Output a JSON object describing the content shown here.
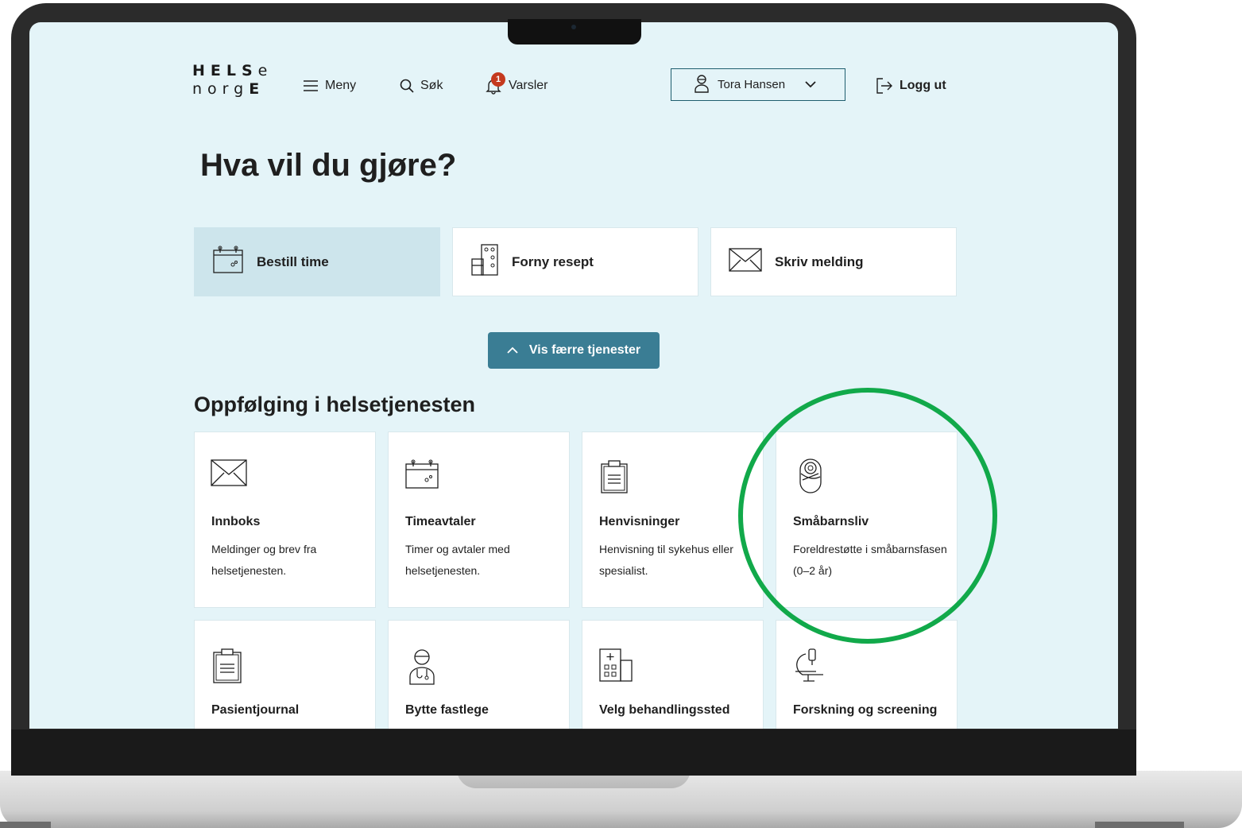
{
  "header": {
    "logo_line1": "HELSe",
    "logo_line2": "norgE",
    "menu_label": "Meny",
    "search_label": "Søk",
    "notifications_label": "Varsler",
    "notifications_count": "1",
    "user_name": "Tora Hansen",
    "logout_label": "Logg ut"
  },
  "main": {
    "heading": "Hva vil du gjøre?",
    "quick_actions": [
      {
        "label": "Bestill time",
        "icon": "calendar-icon",
        "active": true
      },
      {
        "label": "Forny resept",
        "icon": "prescription-icon",
        "active": false
      },
      {
        "label": "Skriv melding",
        "icon": "envelope-icon",
        "active": false
      }
    ],
    "toggle_label": "Vis færre tjenester",
    "section_heading": "Oppfølging i helsetjenesten",
    "cards": [
      {
        "title": "Innboks",
        "desc": "Meldinger og brev fra helsetjenesten.",
        "icon": "envelope-icon"
      },
      {
        "title": "Timeavtaler",
        "desc": "Timer og avtaler med helsetjenesten.",
        "icon": "calendar-icon"
      },
      {
        "title": "Henvisninger",
        "desc": "Henvisning til sykehus eller spesialist.",
        "icon": "clipboard-icon"
      },
      {
        "title": "Småbarnsliv",
        "desc": "Foreldrestøtte i småbarnsfasen (0–2 år)",
        "icon": "baby-icon"
      },
      {
        "title": "Pasientjournal",
        "desc": "",
        "icon": "clipboard-icon"
      },
      {
        "title": "Bytte fastlege",
        "desc": "",
        "icon": "doctor-icon"
      },
      {
        "title": "Velg behandlingssted",
        "desc": "",
        "icon": "hospital-icon"
      },
      {
        "title": "Forskning og screening",
        "desc": "",
        "icon": "microscope-icon"
      }
    ]
  },
  "colors": {
    "screen_bg": "#e4f4f8",
    "button_bg": "#3a7d94",
    "active_tile": "#cde5ec",
    "badge": "#c4391e",
    "highlight_ring": "#11a94a"
  }
}
